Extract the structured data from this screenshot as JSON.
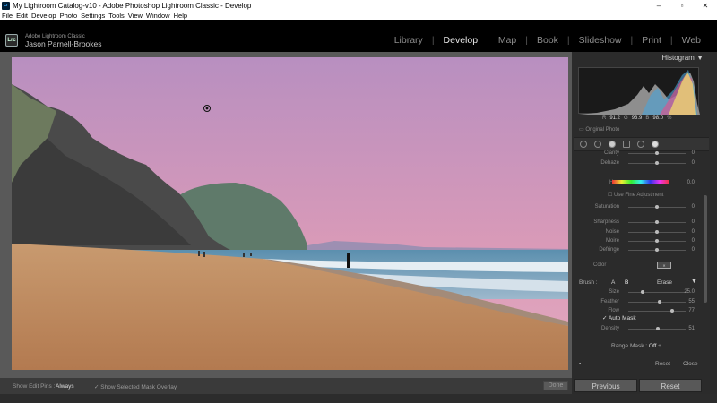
{
  "window": {
    "title": "My Lightroom Catalog-v10 - Adobe Photoshop Lightroom Classic - Develop",
    "app_icon_text": "Lr",
    "minimize": "–",
    "maximize": "▫",
    "close": "✕"
  },
  "menu": [
    "File",
    "Edit",
    "Develop",
    "Photo",
    "Settings",
    "Tools",
    "View",
    "Window",
    "Help"
  ],
  "identity": {
    "logo": "Lrc",
    "product": "Adobe Lightroom Classic",
    "user": "Jason Parnell-Brookes"
  },
  "modules": [
    "Library",
    "Develop",
    "Map",
    "Book",
    "Slideshow",
    "Print",
    "Web"
  ],
  "active_module": "Develop",
  "histogram": {
    "title": "Histogram",
    "r_label": "R",
    "r": "91.2",
    "g_label": "G",
    "g": "93.9",
    "b_label": "B",
    "b": "98.0",
    "unit": "%",
    "original_photo": "Original Photo"
  },
  "sliders_top": [
    {
      "label": "Clarity",
      "value": "0",
      "pos": 0.5
    },
    {
      "label": "Dehaze",
      "value": "0",
      "pos": 0.5
    }
  ],
  "hue": {
    "label": "Hue",
    "value": "0.0",
    "pos": 0.5,
    "use_fine": "Use Fine Adjustment"
  },
  "sliders_mid": [
    {
      "label": "Saturation",
      "value": "0",
      "pos": 0.5
    },
    {
      "label": "Sharpness",
      "value": "0",
      "pos": 0.5
    },
    {
      "label": "Noise",
      "value": "0",
      "pos": 0.5
    },
    {
      "label": "Moiré",
      "value": "0",
      "pos": 0.5
    },
    {
      "label": "Defringe",
      "value": "0",
      "pos": 0.5
    }
  ],
  "color": {
    "label": "Color",
    "swatch": "none"
  },
  "brush": {
    "label": "Brush :",
    "a": "A",
    "b": "B",
    "erase": "Erase",
    "sliders": [
      {
        "label": "Size",
        "value": "25.0",
        "pos": 0.25
      },
      {
        "label": "Feather",
        "value": "55",
        "pos": 0.55
      },
      {
        "label": "Flow",
        "value": "77",
        "pos": 0.77
      }
    ],
    "auto_mask": "Auto Mask",
    "density": {
      "label": "Density",
      "value": "51",
      "pos": 0.51
    }
  },
  "range_mask": {
    "label": "Range Mask :",
    "value": "Off"
  },
  "panel_buttons": {
    "reset": "Reset",
    "close": "Close",
    "previous": "Previous",
    "reset_big": "Reset"
  },
  "toolbar": {
    "show_edit_pins_label": "Show Edit Pins :",
    "show_edit_pins_value": "Always",
    "show_overlay": "Show Selected Mask Overlay",
    "done": "Done"
  }
}
